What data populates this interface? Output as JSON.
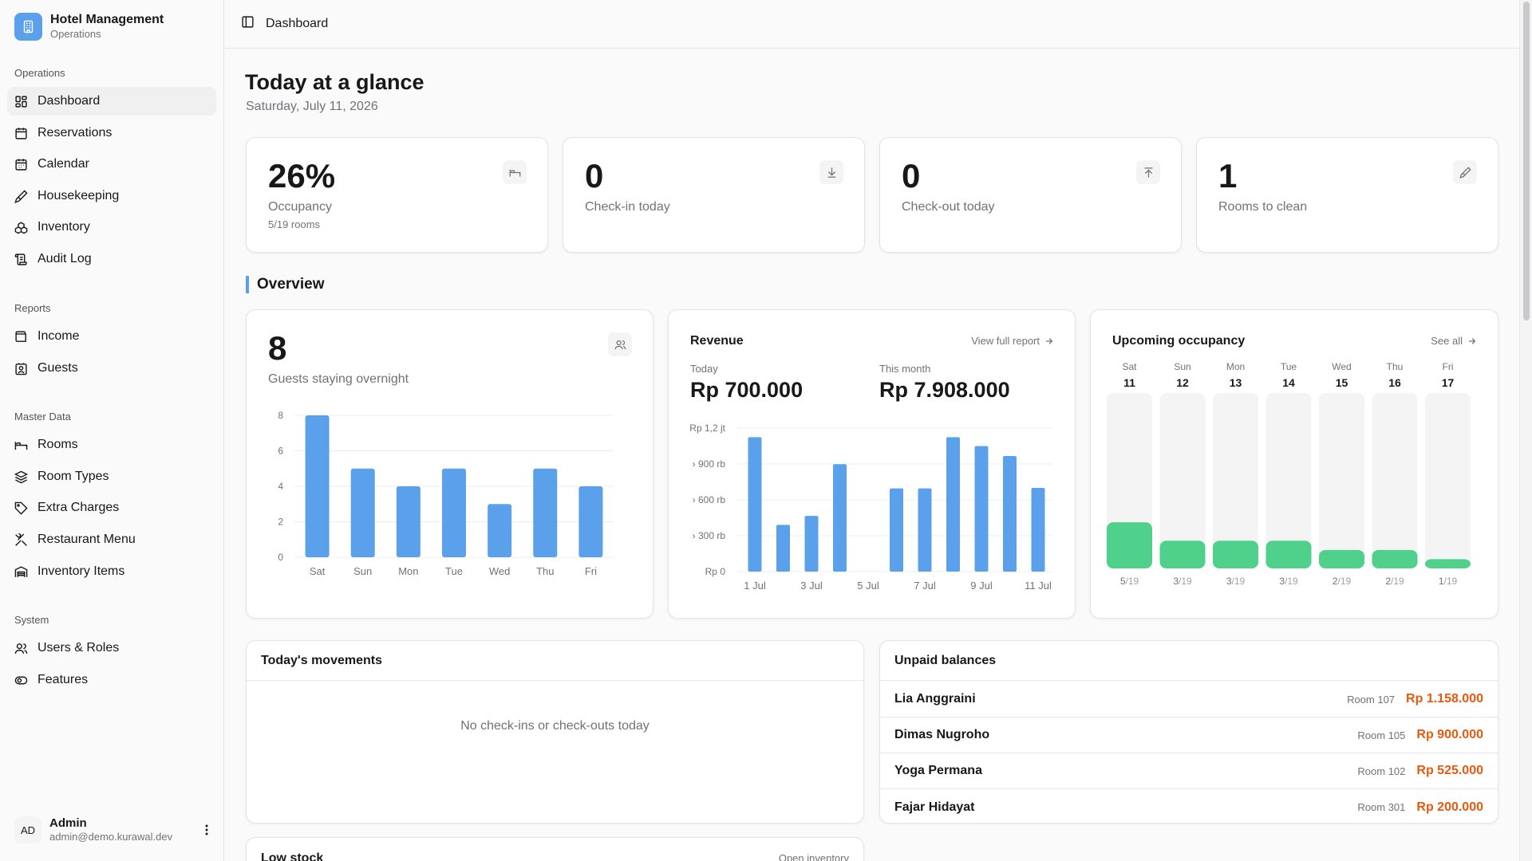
{
  "brand": {
    "title": "Hotel Management",
    "subtitle": "Operations",
    "accent": "#5ba0ea"
  },
  "nav": {
    "groups": [
      {
        "label": "Operations",
        "items": [
          "Dashboard",
          "Reservations",
          "Calendar",
          "Housekeeping",
          "Inventory",
          "Audit Log"
        ]
      },
      {
        "label": "Reports",
        "items": [
          "Income",
          "Guests"
        ]
      },
      {
        "label": "Master Data",
        "items": [
          "Rooms",
          "Room Types",
          "Extra Charges",
          "Restaurant Menu",
          "Inventory Items"
        ]
      },
      {
        "label": "System",
        "items": [
          "Users & Roles",
          "Features"
        ]
      }
    ],
    "active": "Dashboard"
  },
  "user": {
    "initials": "AD",
    "name": "Admin",
    "email": "admin@demo.kurawal.dev"
  },
  "topbar": {
    "title": "Dashboard"
  },
  "page": {
    "title": "Today at a glance",
    "date": "Saturday, July 11, 2026"
  },
  "stats": [
    {
      "value": "26%",
      "label": "Occupancy",
      "sub": "5/19 rooms",
      "icon": "bed-icon"
    },
    {
      "value": "0",
      "label": "Check-in today",
      "sub": "",
      "icon": "download-icon"
    },
    {
      "value": "0",
      "label": "Check-out today",
      "sub": "",
      "icon": "upload-icon"
    },
    {
      "value": "1",
      "label": "Rooms to clean",
      "sub": "",
      "icon": "brush-icon"
    }
  ],
  "overview": {
    "title": "Overview",
    "guests": {
      "value": "8",
      "label": "Guests staying overnight",
      "icon": "users-icon"
    },
    "revenue": {
      "title": "Revenue",
      "link": "View full report",
      "today_label": "Today",
      "today_value": "Rp 700.000",
      "month_label": "This month",
      "month_value": "Rp 7.908.000"
    },
    "occupancy": {
      "title": "Upcoming occupancy",
      "link": "See all"
    }
  },
  "chart_data": [
    {
      "type": "bar",
      "categories": [
        "Sat",
        "Sun",
        "Mon",
        "Tue",
        "Wed",
        "Thu",
        "Fri"
      ],
      "values": [
        8,
        5,
        4,
        5,
        3,
        5,
        4
      ],
      "ylim": [
        0,
        8
      ],
      "yticks": [
        "0",
        "2",
        "4",
        "6",
        "8"
      ],
      "grid": true,
      "color": "#5ba0ea"
    },
    {
      "type": "bar",
      "x": [
        "1 Jul",
        "2 Jul",
        "3 Jul",
        "4 Jul",
        "5 Jul",
        "6 Jul",
        "7 Jul",
        "8 Jul",
        "9 Jul",
        "10 Jul",
        "11 Jul"
      ],
      "xticks": [
        "1 Jul",
        "3 Jul",
        "5 Jul",
        "7 Jul",
        "9 Jul",
        "11 Jul"
      ],
      "values": [
        1124000,
        391000,
        466000,
        898000,
        0,
        696000,
        696000,
        1124000,
        1050000,
        967000,
        700000
      ],
      "ylim": [
        0,
        1200000
      ],
      "yticks": [
        "Rp 0",
        "› 300 rb",
        "› 600 rb",
        "› 900 rb",
        "Rp 1,2 jt"
      ],
      "grid": true,
      "color": "#5ba0ea"
    },
    {
      "type": "bar",
      "days": [
        {
          "dow": "Sat",
          "date": "11",
          "occ": 5
        },
        {
          "dow": "Sun",
          "date": "12",
          "occ": 3
        },
        {
          "dow": "Mon",
          "date": "13",
          "occ": 3
        },
        {
          "dow": "Tue",
          "date": "14",
          "occ": 3
        },
        {
          "dow": "Wed",
          "date": "15",
          "occ": 2
        },
        {
          "dow": "Thu",
          "date": "16",
          "occ": 2
        },
        {
          "dow": "Fri",
          "date": "17",
          "occ": 1
        }
      ],
      "total": 19,
      "total_label": "/19",
      "color": "#4fd18b"
    }
  ],
  "movements": {
    "title": "Today's movements",
    "empty": "No check-ins or check-outs today"
  },
  "balances": {
    "title": "Unpaid balances",
    "rows": [
      {
        "name": "Lia Anggraini",
        "room": "Room 107",
        "amount": "Rp 1.158.000"
      },
      {
        "name": "Dimas Nugroho",
        "room": "Room 105",
        "amount": "Rp 900.000"
      },
      {
        "name": "Yoga Permana",
        "room": "Room 102",
        "amount": "Rp 525.000"
      },
      {
        "name": "Fajar Hidayat",
        "room": "Room 301",
        "amount": "Rp 200.000"
      }
    ]
  },
  "low_stock": {
    "title": "Low stock",
    "link": "Open inventory"
  }
}
